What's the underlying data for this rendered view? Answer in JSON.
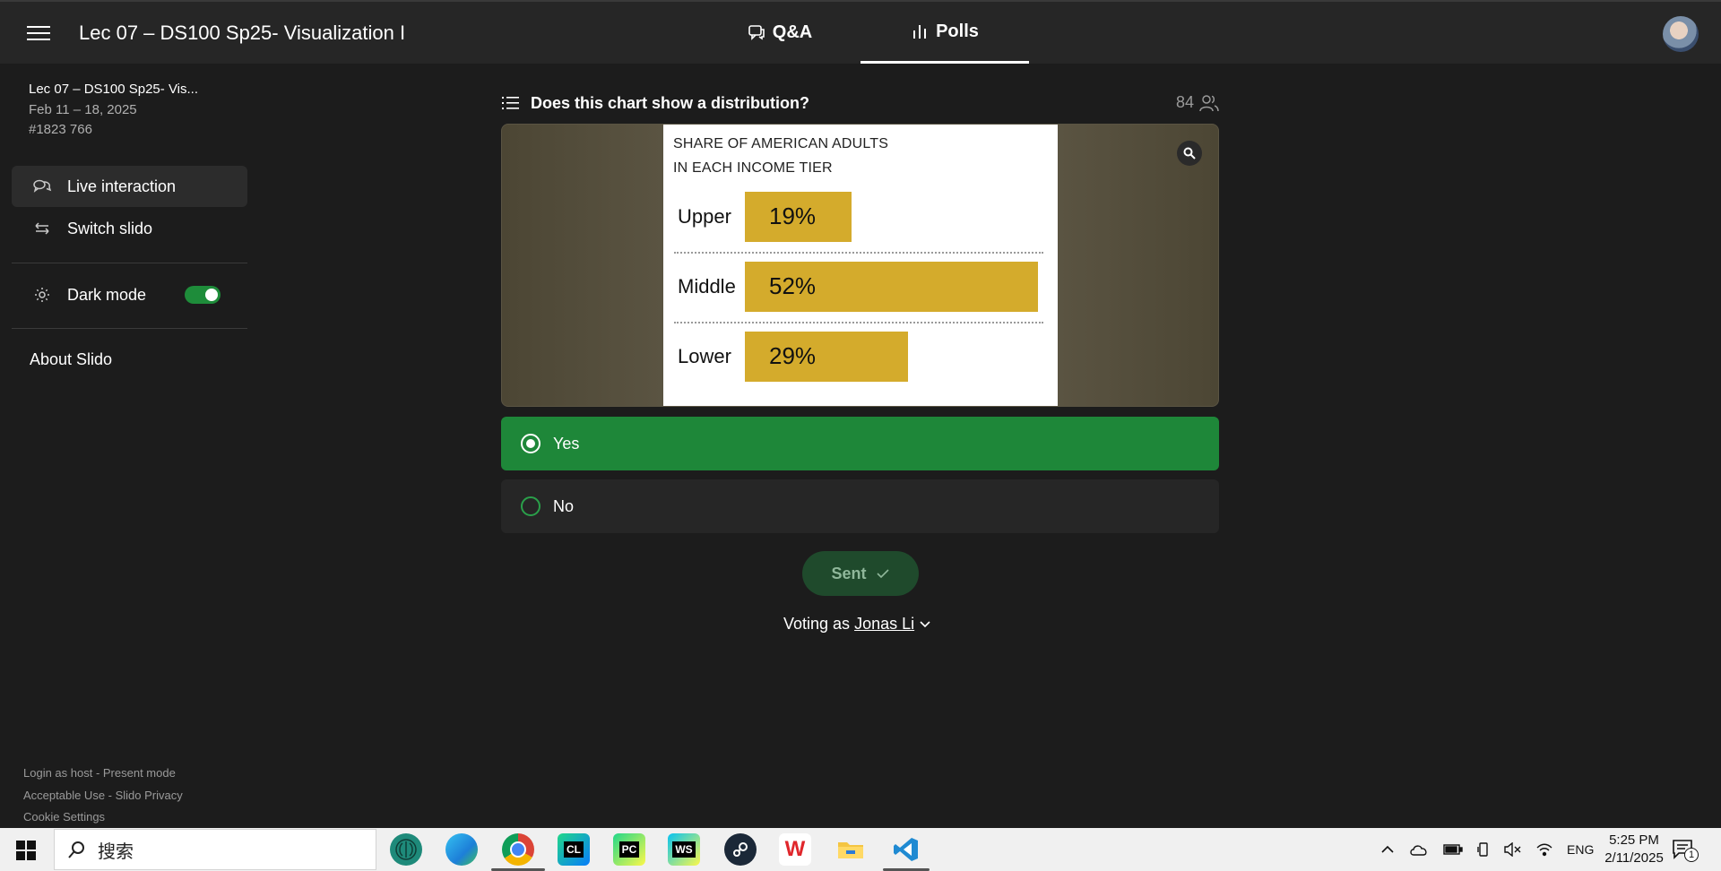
{
  "header": {
    "event_title": "Lec 07 – DS100 Sp25- Visualization I",
    "tabs": [
      {
        "label": "Q&A",
        "icon": "chat-bubbles-icon",
        "active": false
      },
      {
        "label": "Polls",
        "icon": "bar-chart-icon",
        "active": true
      }
    ]
  },
  "sidebar": {
    "event_name": "Lec 07 – DS100 Sp25- Vis...",
    "event_dates": "Feb 11 – 18, 2025",
    "event_code": "#1823 766",
    "items": [
      {
        "label": "Live interaction",
        "icon": "chat-bubbles-icon",
        "active": true
      },
      {
        "label": "Switch slido",
        "icon": "swap-arrows-icon"
      },
      {
        "label": "Dark mode",
        "icon": "gear-icon",
        "toggle_on": true
      }
    ],
    "about": "About Slido",
    "footer_lines": [
      "Login as host - Present mode",
      "Acceptable Use - Slido Privacy",
      "Cookie Settings"
    ]
  },
  "poll": {
    "question": "Does this chart show a distribution?",
    "participant_count": "84",
    "options": [
      {
        "label": "Yes",
        "selected": true
      },
      {
        "label": "No",
        "selected": false
      }
    ],
    "sent_label": "Sent",
    "voting_prefix": "Voting as",
    "voting_name": "Jonas Li"
  },
  "chart_data": {
    "type": "bar",
    "orientation": "horizontal",
    "title": "SHARE OF AMERICAN ADULTS\nIN EACH INCOME TIER",
    "title_lines": [
      "SHARE OF AMERICAN ADULTS",
      "IN EACH INCOME TIER"
    ],
    "categories": [
      "Upper",
      "Middle",
      "Lower"
    ],
    "values": [
      19,
      52,
      29
    ],
    "value_labels": [
      "19%",
      "52%",
      "29%"
    ],
    "bar_color": "#d4ab2c",
    "xlim": [
      0,
      52
    ]
  },
  "taskbar": {
    "search_placeholder": "搜索",
    "apps": [
      {
        "name": "brain-app-icon",
        "label": ""
      },
      {
        "name": "edge-browser-icon",
        "label": ""
      },
      {
        "name": "chrome-browser-icon",
        "label": ""
      },
      {
        "name": "clion-icon",
        "label": "CL"
      },
      {
        "name": "pycharm-icon",
        "label": "PC"
      },
      {
        "name": "webstorm-icon",
        "label": "WS"
      },
      {
        "name": "steam-icon",
        "label": ""
      },
      {
        "name": "wps-icon",
        "label": "W"
      },
      {
        "name": "file-explorer-icon",
        "label": ""
      },
      {
        "name": "vscode-icon",
        "label": ""
      }
    ],
    "language": "ENG",
    "time": "5:25 PM",
    "date": "2/11/2025",
    "notification_count": "1"
  },
  "colors": {
    "accent_green": "#1e8739",
    "background": "#1c1c1c",
    "header": "#262626"
  }
}
